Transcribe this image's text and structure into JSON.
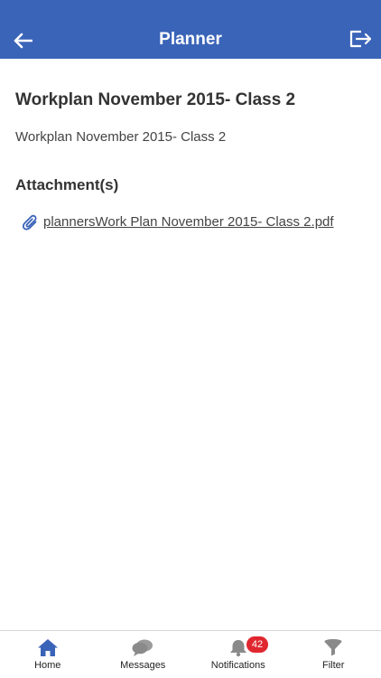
{
  "header": {
    "title": "Planner",
    "back_icon": "arrow-left-icon",
    "logout_icon": "logout-icon",
    "bg_color": "#3a64b8"
  },
  "content": {
    "title": "Workplan November 2015- Class 2",
    "description": "Workplan November 2015- Class 2",
    "attachments_heading": "Attachment(s)",
    "attachments": [
      {
        "icon": "paperclip-icon",
        "filename": "plannersWork Plan November 2015- Class 2.pdf"
      }
    ]
  },
  "bottom_nav": {
    "items": [
      {
        "label": "Home",
        "icon": "home-icon",
        "color": "#3a64b8"
      },
      {
        "label": "Messages",
        "icon": "chat-icon",
        "color": "#8a8a8a"
      },
      {
        "label": "Notifications",
        "icon": "bell-icon",
        "color": "#8a8a8a",
        "badge": "42"
      },
      {
        "label": "Filter",
        "icon": "funnel-icon",
        "color": "#8a8a8a"
      }
    ],
    "badge_color": "#e0262f"
  }
}
